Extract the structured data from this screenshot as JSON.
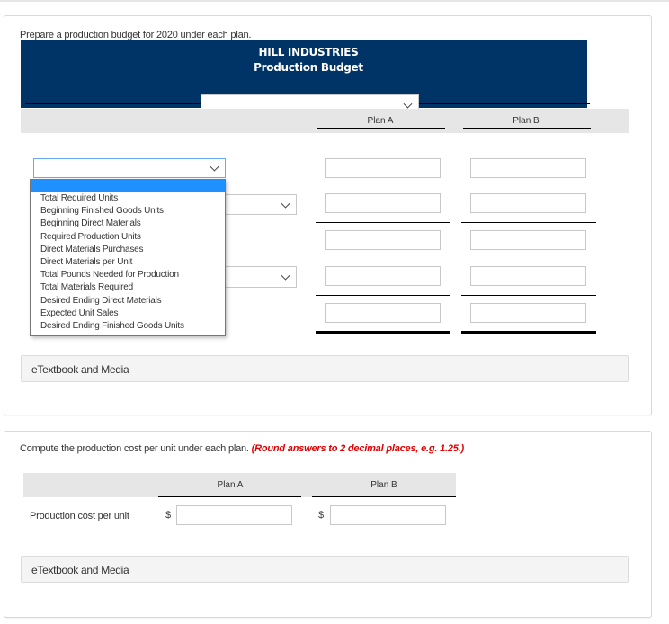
{
  "part1": {
    "prompt": "Prepare a production budget for 2020 under each plan.",
    "header": {
      "company": "HILL INDUSTRIES",
      "title": "Production Budget",
      "period_select": {
        "value": "",
        "options": []
      }
    },
    "columns": [
      "Plan A",
      "Plan B"
    ],
    "row_selects": [
      {
        "value": "",
        "open": true
      },
      {
        "value": ""
      },
      {
        "value": ""
      }
    ],
    "dropdown_options": [
      "",
      "Total Required Units",
      "Beginning Finished Goods Units",
      "Beginning Direct Materials",
      "Required Production Units",
      "Direct Materials Purchases",
      "Direct Materials per Unit",
      "Total Pounds Needed for Production",
      "Total Materials Required",
      "Desired Ending Direct Materials",
      "Expected Unit Sales",
      "Desired Ending Finished Goods Units"
    ],
    "rows": [
      {
        "plan_a": "",
        "plan_b": ""
      },
      {
        "plan_a": "",
        "plan_b": ""
      },
      {
        "plan_a": "",
        "plan_b": ""
      },
      {
        "plan_a": "",
        "plan_b": ""
      },
      {
        "plan_a": "",
        "plan_b": ""
      }
    ],
    "media_label": "eTextbook and Media"
  },
  "part2": {
    "prompt": "Compute the production cost per unit under each plan.",
    "hint": "(Round answers to 2 decimal places, e.g. 1.25.)",
    "columns": [
      "Plan A",
      "Plan B"
    ],
    "row_label": "Production cost per unit",
    "currency": "$",
    "plan_a": "",
    "plan_b": "",
    "media_label": "eTextbook and Media"
  },
  "colors": {
    "header_bg": "#003366",
    "hint": "#e00000",
    "selected_option": "#1e90ff"
  }
}
